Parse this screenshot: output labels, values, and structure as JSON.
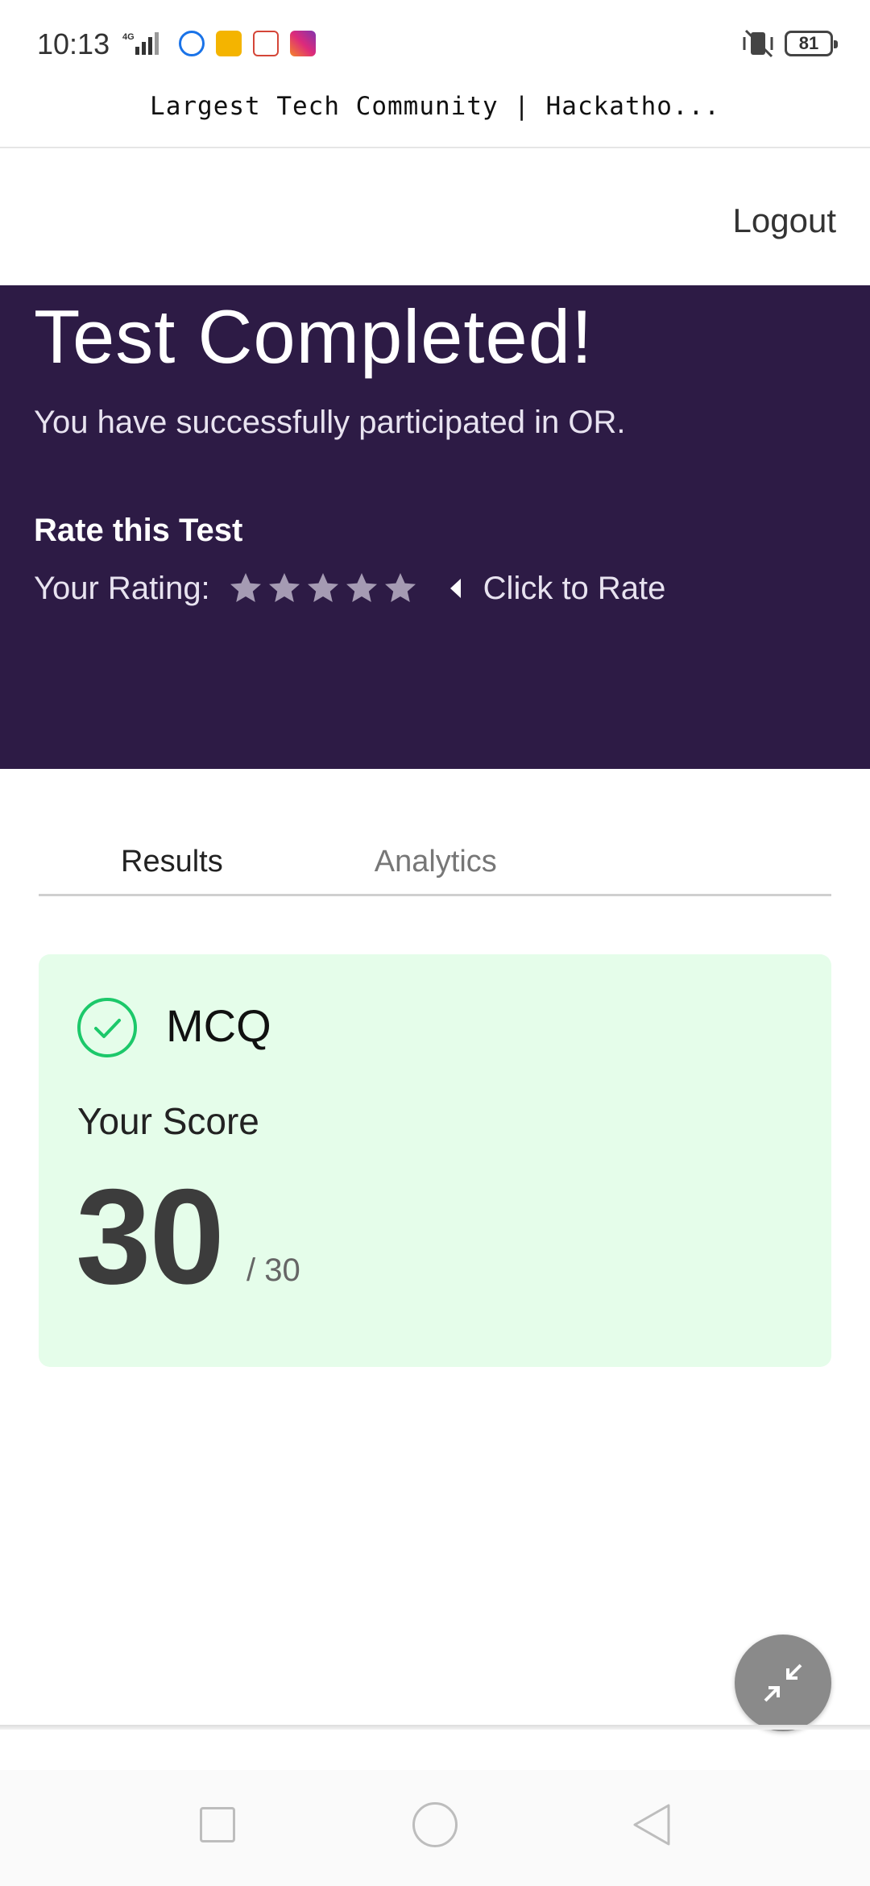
{
  "status_bar": {
    "time": "10:13",
    "network": "4G",
    "battery": "81"
  },
  "page": {
    "title": "Largest Tech Community | Hackatho..."
  },
  "header": {
    "logout_label": "Logout"
  },
  "hero": {
    "title": "Test Completed!",
    "subtitle": "You have successfully participated in OR.",
    "rate_heading": "Rate this Test",
    "rating_label": "Your Rating:",
    "rating_value": 0,
    "rating_max": 5,
    "rate_hint": "Click to Rate",
    "background_color": "#2d1b45"
  },
  "tabs": [
    {
      "label": "Results",
      "active": true
    },
    {
      "label": "Analytics",
      "active": false
    }
  ],
  "result": {
    "section": "MCQ",
    "status_icon": "check-circle-icon",
    "score_label": "Your Score",
    "score": "30",
    "total": "/ 30",
    "card_color": "#e5fdea",
    "accent_color": "#1cc86a"
  },
  "fab": {
    "icon": "minimize-icon"
  },
  "nav_bar": {
    "icons": [
      "recents-icon",
      "home-icon",
      "back-icon"
    ]
  }
}
